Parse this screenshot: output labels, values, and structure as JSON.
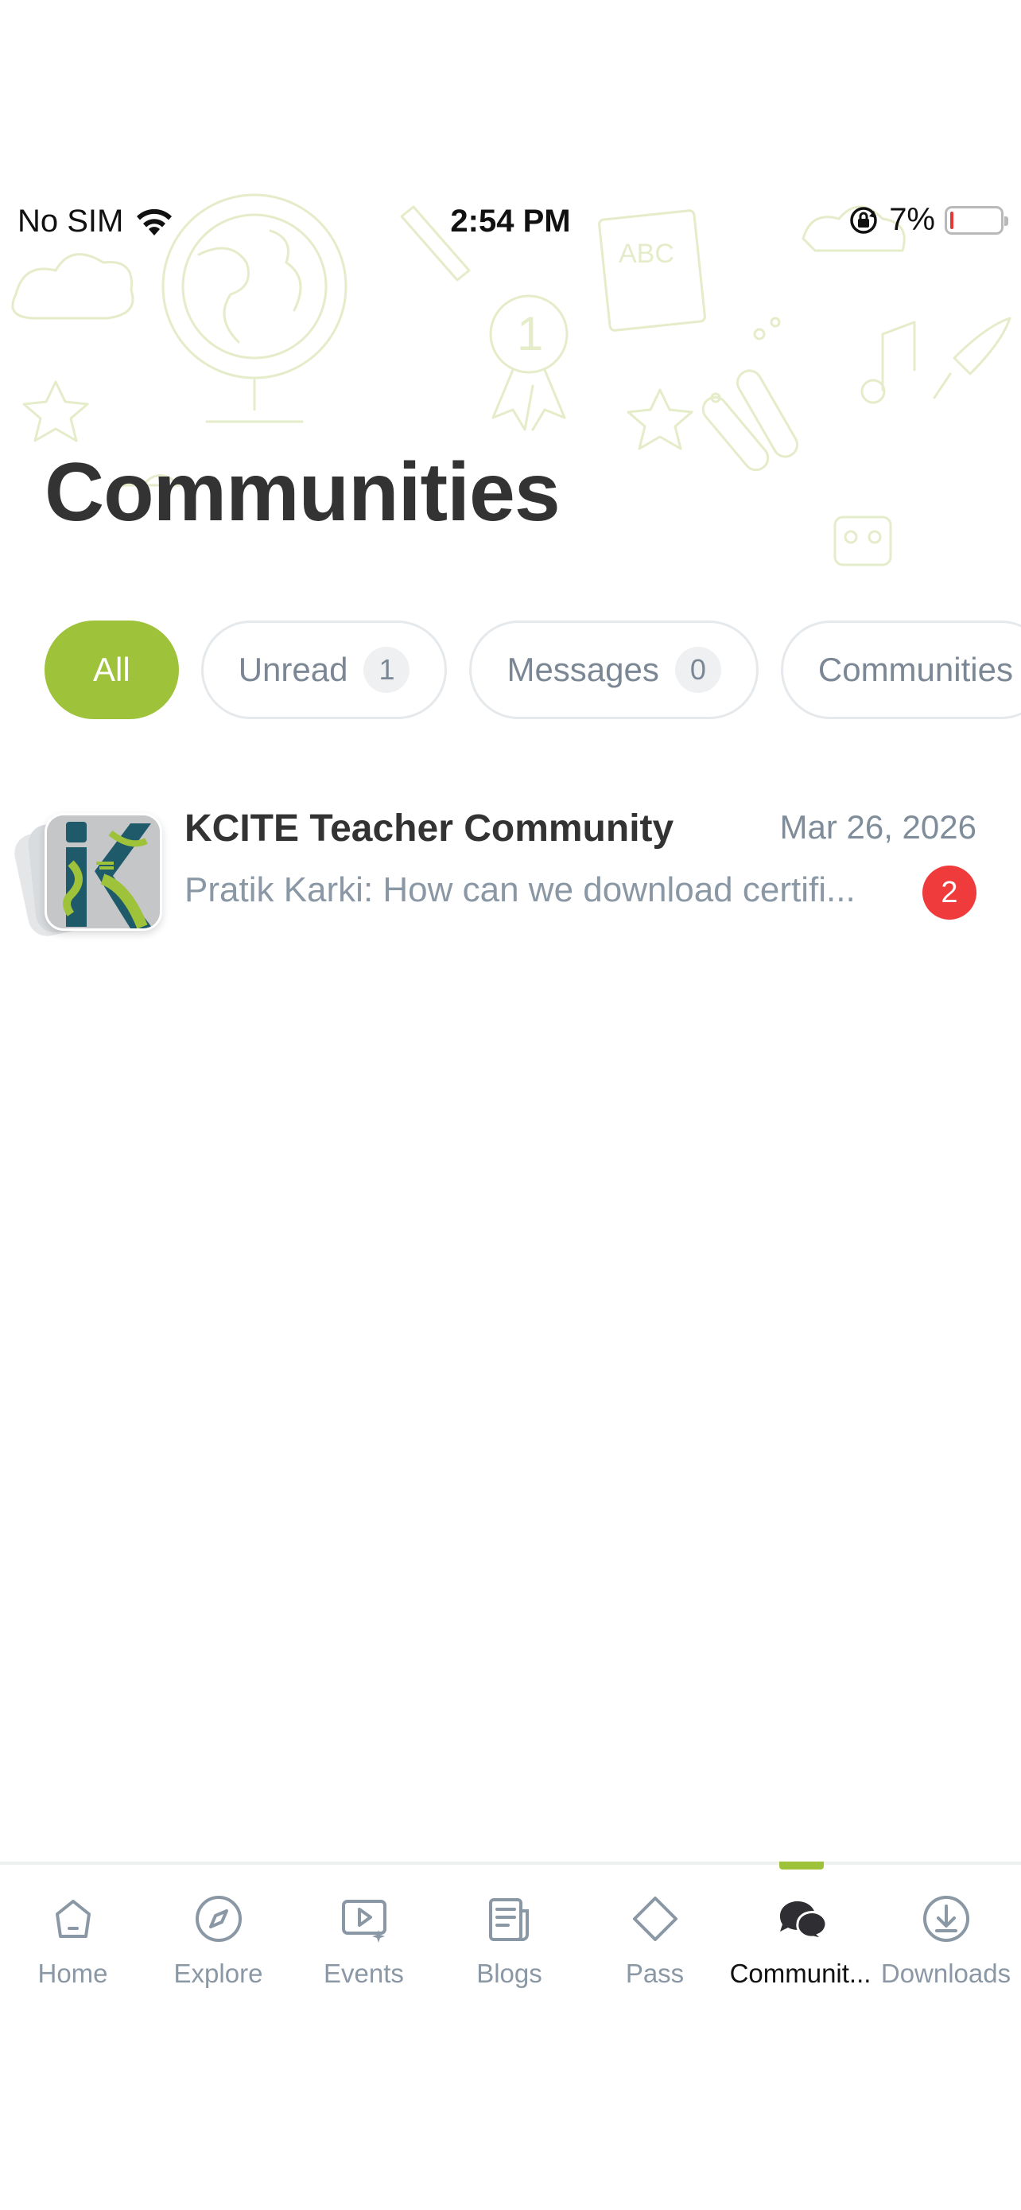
{
  "status_bar": {
    "carrier": "No SIM",
    "time": "2:54 PM",
    "battery_percent": "7%",
    "battery_level": 0.07
  },
  "page": {
    "title": "Communities"
  },
  "filters": [
    {
      "label": "All",
      "count": null,
      "active": true
    },
    {
      "label": "Unread",
      "count": "1",
      "active": false
    },
    {
      "label": "Messages",
      "count": "0",
      "active": false
    },
    {
      "label": "Communities",
      "count": null,
      "active": false
    }
  ],
  "communities": [
    {
      "name": "KCITE Teacher Community",
      "date": "Mar 26, 2026",
      "preview": "Pratik Karki: How can we download certifi...",
      "unread": "2"
    }
  ],
  "tabs": [
    {
      "label": "Home",
      "icon": "home-icon",
      "active": false
    },
    {
      "label": "Explore",
      "icon": "compass-icon",
      "active": false
    },
    {
      "label": "Events",
      "icon": "video-sparkle-icon",
      "active": false
    },
    {
      "label": "Blogs",
      "icon": "newspaper-icon",
      "active": false
    },
    {
      "label": "Pass",
      "icon": "diamond-icon",
      "active": false
    },
    {
      "label": "Communit...",
      "icon": "chat-bubbles-icon",
      "active": true
    },
    {
      "label": "Downloads",
      "icon": "download-icon",
      "active": false
    }
  ],
  "colors": {
    "accent": "#9ec23a",
    "badge": "#ef3b3b",
    "muted_text": "#8a97a5"
  }
}
